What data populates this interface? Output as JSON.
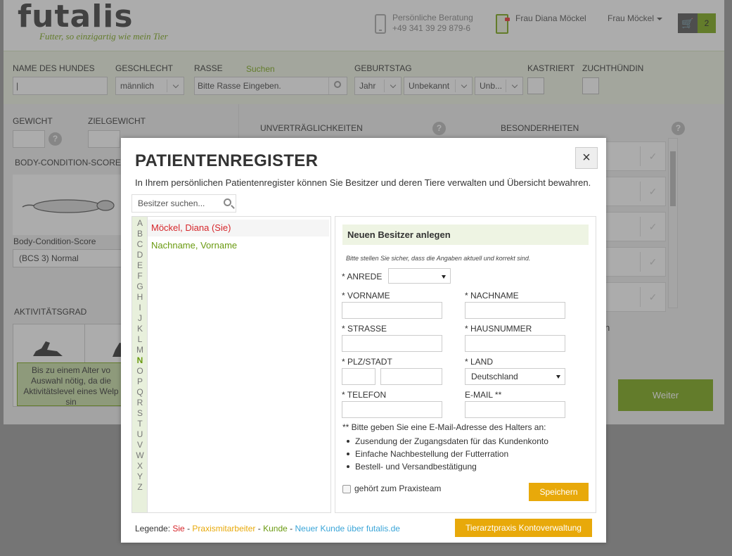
{
  "header": {
    "logo": "futalis",
    "tagline": "Futter, so einzigartig wie mein Tier",
    "beratung_label": "Persönliche Beratung",
    "beratung_phone": "+49 341 39 29 879-6",
    "user_name": "Frau Diana Möckel",
    "user_menu": "Frau Möckel",
    "cart_count": "2"
  },
  "filter": {
    "name_label": "NAME DES HUNDES",
    "gender_label": "GESCHLECHT",
    "gender_value": "männlich",
    "breed_label": "RASSE",
    "breed_search": "Suchen",
    "breed_placeholder": "Bitte Rasse Eingeben.",
    "birthday_label": "GEBURTSTAG",
    "year_value": "Jahr",
    "month_value": "Unbekannt",
    "day_value": "Unb...",
    "neutered_label": "KASTRIERT",
    "breeding_label": "ZUCHTHÜNDIN"
  },
  "body": {
    "weight_label": "GEWICHT",
    "target_label": "ZIELGEWICHT",
    "help": "?",
    "bcs_label": "BODY-CONDITION-SCORE",
    "bcs_caption": "Body-Condition-Score",
    "bcs_value": "(BCS 3) Normal",
    "intolerance_label": "UNVERTRÄGLICHKEITEN",
    "special_label": "BESONDERHEITEN",
    "activity_label": "AKTIVITÄTSGRAD",
    "activity_note": [
      "Bis zu einem Alter vo",
      "Auswahl nötig, da die",
      "Aktivitätslevel eines Welp",
      "sin"
    ],
    "fragment_n": "n",
    "next_button": "Weiter"
  },
  "modal": {
    "title": "PATIENTENREGISTER",
    "close": "×",
    "intro": "In Ihrem persönlichen Patientenregister können Sie Besitzer und deren Tiere verwalten und Übersicht bewahren.",
    "search_placeholder": "Besitzer suchen...",
    "alphabet": [
      "A",
      "B",
      "C",
      "D",
      "E",
      "F",
      "G",
      "H",
      "I",
      "J",
      "K",
      "L",
      "M",
      "N",
      "O",
      "P",
      "Q",
      "R",
      "S",
      "T",
      "U",
      "V",
      "W",
      "X",
      "Y",
      "Z"
    ],
    "active_letter": "N",
    "owners": [
      {
        "name": "Möckel, Diana (Sie)",
        "type": "sie"
      },
      {
        "name": "Nachname, Vorname",
        "type": "kunde"
      }
    ],
    "form": {
      "heading": "Neuen Besitzer anlegen",
      "note": "Bitte stellen Sie sicher, dass die Angaben aktuell und korrekt sind.",
      "salutation_label": "* ANREDE",
      "salutation_value": "",
      "firstname_label": "* VORNAME",
      "lastname_label": "* NACHNAME",
      "street_label": "* STRASSE",
      "housenumber_label": "* HAUSNUMMER",
      "zipcity_label": "* PLZ/STADT",
      "country_label": "* LAND",
      "country_value": "Deutschland",
      "phone_label": "* TELEFON",
      "email_label": "E-MAIL **",
      "hint": "** Bitte geben Sie eine E-Mail-Adresse des Halters an:",
      "bullets": [
        "Zusendung der Zugangsdaten für das Kundenkonto",
        "Einfache Nachbestellung der Futterration",
        "Bestell- und Versandbestätigung"
      ],
      "team_label": "gehört zum Praxisteam",
      "save": "Speichern"
    },
    "legend": {
      "prefix": "Legende: ",
      "sie": "Sie",
      "sep": " - ",
      "praxis": "Praxismitarbeiter",
      "kunde": "Kunde",
      "neukunde": "Neuer Kunde über futalis.de"
    },
    "account_button": "Tierarztpraxis Kontoverwaltung"
  },
  "colors": {
    "brand_green": "#7aa815",
    "accent_orange": "#e8a90a",
    "self_red": "#d6262b",
    "new_customer_blue": "#3aa5d8"
  }
}
